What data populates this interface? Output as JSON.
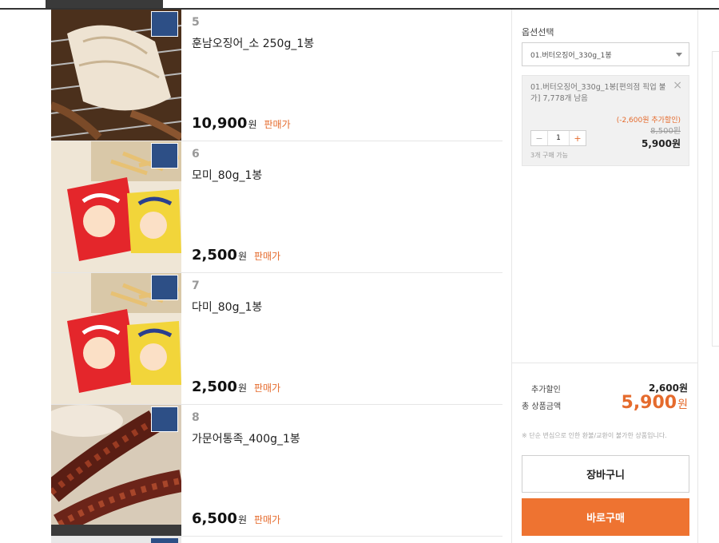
{
  "products": [
    {
      "num": "5",
      "name": "훈남오징어_소 250g_1봉",
      "price": "10,900",
      "currency": "원",
      "tag": "판매가",
      "image": "grilled-squid"
    },
    {
      "num": "6",
      "name": "모미_80g_1봉",
      "price": "2,500",
      "currency": "원",
      "tag": "판매가",
      "image": "snack-packs"
    },
    {
      "num": "7",
      "name": "다미_80g_1봉",
      "price": "2,500",
      "currency": "원",
      "tag": "판매가",
      "image": "snack-packs"
    },
    {
      "num": "8",
      "name": "가문어통족_400g_1봉",
      "price": "6,500",
      "currency": "원",
      "tag": "판매가",
      "image": "grilled-legs"
    }
  ],
  "panel": {
    "option_title": "옵션선택",
    "select_value": "01.버터오징어_330g_1봉",
    "selected": {
      "desc": "01.버터오징어_330g_1봉[편의점 픽업 불가]  7,778개 남음",
      "discount": "(-2,600원 추가할인)",
      "original_price": "8,500원",
      "final_price": "5,900원",
      "quantity": "1",
      "limit": "3개 구매 가능"
    },
    "extra_discount_label": "추가할인",
    "extra_discount_value": "2,600원",
    "total_label": "총 상품금액",
    "total_value": "5,900",
    "total_unit": "원",
    "notice": "※ 단순 변심으로 인한 환불/교환이 불가한 상품입니다.",
    "cart_button": "장바구니",
    "buy_button": "바로구매"
  },
  "colors": {
    "accent": "#ee7331",
    "sale_text": "#e56b2d",
    "badge": "#2d4f86"
  }
}
